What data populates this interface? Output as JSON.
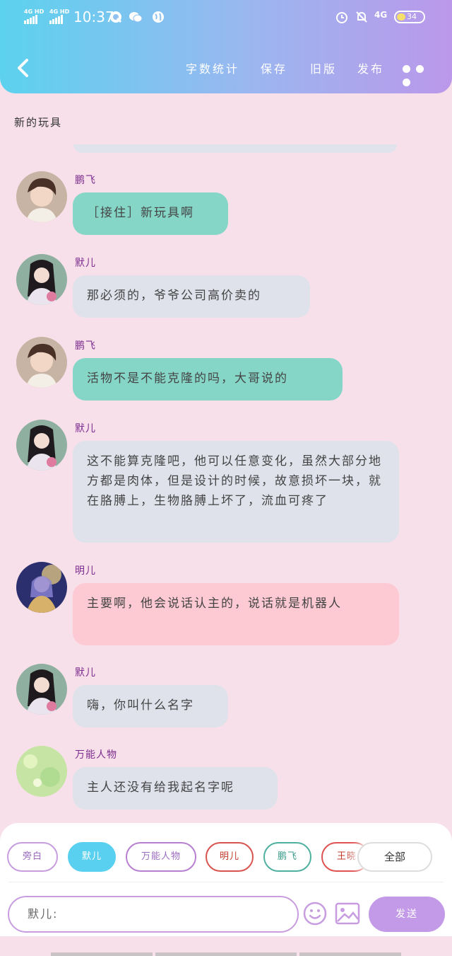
{
  "status_bar": {
    "signal1": "4G HD",
    "signal2": "4G HD",
    "time": "10:37",
    "network": "4G",
    "battery": "34"
  },
  "toolbar": {
    "word_count": "字数统计",
    "save": "保存",
    "old_version": "旧版",
    "publish": "发布"
  },
  "document": {
    "title": "新的玩具"
  },
  "messages": [
    {
      "name": "鹏飞",
      "text": "［接住］新玩具啊",
      "color": "#86d6c8"
    },
    {
      "name": "默儿",
      "text": "那必须的，爷爷公司高价卖的",
      "color": "#dfe2eb"
    },
    {
      "name": "鹏飞",
      "text": "活物不是不能克隆的吗，大哥说的",
      "color": "#86d6c8"
    },
    {
      "name": "默儿",
      "text": "这不能算克隆吧，他可以任意变化，虽然大部分地方都是肉体，但是设计的时候，故意损坏一块，就在胳膊上，生物胳膊上坏了，流血可疼了",
      "color": "#dfe2eb"
    },
    {
      "name": "明儿",
      "text": "主要啊，他会说话认主的，说话就是机器人",
      "color": "#fdc9d3"
    },
    {
      "name": "默儿",
      "text": "嗨，你叫什么名字",
      "color": "#dfe2eb"
    },
    {
      "name": "万能人物",
      "text": "主人还没有给我起名字呢",
      "color": "#dfe2eb"
    }
  ],
  "characters": [
    {
      "label": "旁白",
      "color": "#c79de0",
      "text_color": "#9b6bc0"
    },
    {
      "label": "默儿",
      "color": "#5ad0f0",
      "text_color": "#ffffff",
      "selected": true
    },
    {
      "label": "万能人物",
      "color": "#b87fd0",
      "text_color": "#9b6bc0"
    },
    {
      "label": "明儿",
      "color": "#d9534f",
      "text_color": "#c0392b"
    },
    {
      "label": "鹏飞",
      "color": "#4fb0a0",
      "text_color": "#3a9a8a"
    },
    {
      "label": "王晓",
      "color": "#e05252",
      "text_color": "#c0392b"
    }
  ],
  "all_button": "全部",
  "input": {
    "value": "默儿:"
  },
  "send_button": "发送",
  "colors": {
    "header_start": "#5cd2ef",
    "header_end": "#bb98ea",
    "background": "#f8e0ea",
    "send": "#c39ae7"
  }
}
